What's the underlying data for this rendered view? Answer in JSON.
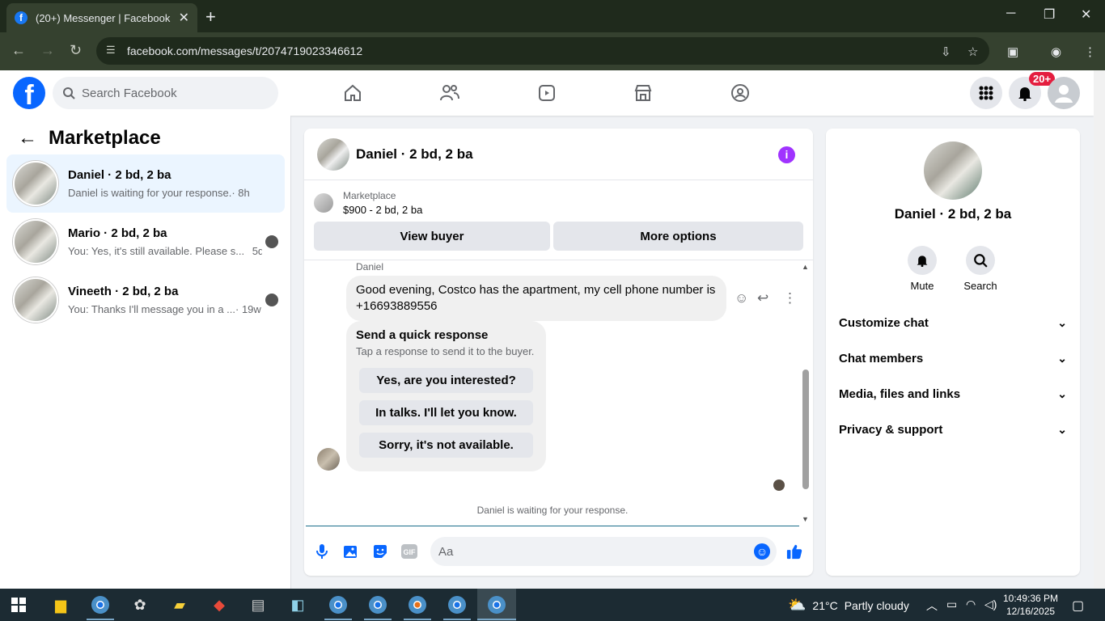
{
  "browser": {
    "tab_title": "(20+) Messenger | Facebook",
    "favicon_letter": "f",
    "url": "facebook.com/messages/t/2074719023346612"
  },
  "header": {
    "logo_letter": "f",
    "search_placeholder": "Search Facebook",
    "notification_badge": "20+"
  },
  "sidebar": {
    "title": "Marketplace",
    "conversations": [
      {
        "name": "Daniel · 2 bd, 2 ba",
        "last": "Daniel is waiting for your response.",
        "time": "· 8h"
      },
      {
        "name": "Mario · 2 bd, 2 ba",
        "last": "You: Yes, it's still available. Please s...",
        "time": "5d"
      },
      {
        "name": "Vineeth · 2 bd, 2 ba",
        "last": "You: Thanks I'll message you in a ...",
        "time": "· 19w"
      }
    ]
  },
  "chat": {
    "title": "Daniel · 2 bd, 2 ba",
    "marketplace_label": "Marketplace",
    "listing": "$900 - 2 bd, 2 ba",
    "view_buyer": "View buyer",
    "more_options": "More options",
    "sender": "Daniel",
    "message": "Good evening, Costco has the apartment, my cell phone number is +16693889556",
    "quick": {
      "title": "Send a quick response",
      "subtitle": "Tap a response to send it to the buyer.",
      "options": [
        "Yes, are you interested?",
        "In talks. I'll let you know.",
        "Sorry, it's not available."
      ]
    },
    "waiting": "Daniel is waiting for your response.",
    "composer_placeholder": "Aa",
    "gif_label": "GIF"
  },
  "details": {
    "name": "Daniel · 2 bd, 2 ba",
    "mute": "Mute",
    "search": "Search",
    "sections": [
      "Customize chat",
      "Chat members",
      "Media, files and links",
      "Privacy & support"
    ]
  },
  "taskbar": {
    "temperature": "21°C",
    "weather": "Partly cloudy",
    "time": "10:49:36 PM",
    "date": "12/16/2025"
  }
}
